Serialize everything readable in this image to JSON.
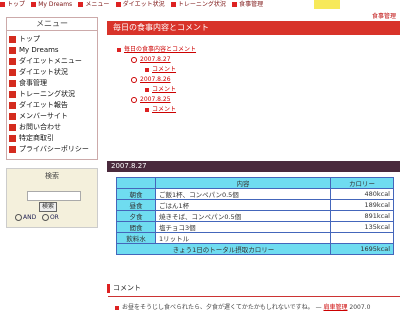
{
  "topnav": {
    "items": [
      "トップ",
      "My Dreams",
      "メニュー",
      "ダイエット状況",
      "トレーニング状況",
      "食事管理"
    ],
    "right_link": "食事管理"
  },
  "sidebar": {
    "menu_title": "メニュー",
    "items": [
      "トップ",
      "My Dreams",
      "ダイエットメニュー",
      "ダイエット状況",
      "食事管理",
      "トレーニング状況",
      "ダイエット報告",
      "メンバーサイト",
      "お問い合わせ",
      "特定商取引",
      "プライバシーポリシー"
    ],
    "search_title": "検索",
    "search_button": "検索",
    "radio_and": "AND",
    "radio_or": "OR"
  },
  "main": {
    "title": "毎日の食事内容とコメント",
    "toc": {
      "root": "毎日の食事内容とコメント",
      "entries": [
        {
          "date": "2007.8.27",
          "sub": "コメント"
        },
        {
          "date": "2007.8.26",
          "sub": "コメント"
        },
        {
          "date": "2007.8.25",
          "sub": "コメント"
        }
      ]
    },
    "date_heading": "2007.8.27",
    "table": {
      "headers": [
        "",
        "内容",
        "カロリー"
      ],
      "rows": [
        {
          "label": "朝食",
          "food": "ご飯1杯、コンペパン0.5個",
          "cal": "480kcal"
        },
        {
          "label": "昼食",
          "food": "ごはん1杯",
          "cal": "189kcal"
        },
        {
          "label": "夕食",
          "food": "焼きそば、コンペパン0.5個",
          "cal": "891kcal"
        },
        {
          "label": "間食",
          "food": "塩チョコ3個",
          "cal": "135kcal"
        },
        {
          "label": "飲料水",
          "food": "1リットル",
          "cal": ""
        }
      ],
      "total_label": "きょう1日のトータル摂取カロリー",
      "total_value": "1695kcal"
    },
    "comment_heading": "コメント",
    "comment_text": "お昼をそうじし食べられたら、夕食が遅くてかたかもしれないですね。",
    "comment_author": "肩車管理",
    "comment_date": "2007.0"
  }
}
